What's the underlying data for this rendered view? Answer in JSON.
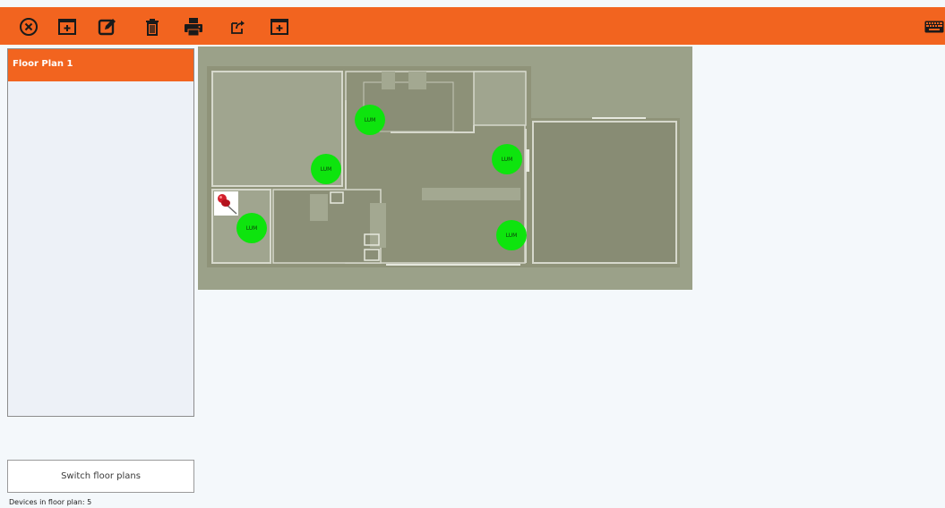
{
  "colors": {
    "accent": "#f2641f",
    "device_fill": "#0ee40e",
    "panel_bg": "#edf1f7"
  },
  "toolbar": {
    "buttons": [
      {
        "name": "close",
        "icon": "circle-x-icon"
      },
      {
        "name": "add",
        "icon": "add-box-icon"
      },
      {
        "name": "edit",
        "icon": "edit-icon"
      },
      {
        "name": "delete",
        "icon": "trash-icon"
      },
      {
        "name": "print",
        "icon": "printer-icon"
      },
      {
        "name": "export",
        "icon": "external-link-icon"
      },
      {
        "name": "add-secondary",
        "icon": "add-box-icon"
      }
    ],
    "right_icon": "keyboard-icon"
  },
  "sidebar": {
    "items": [
      {
        "label": "Floor Plan 1",
        "selected": true
      }
    ]
  },
  "switch_button": {
    "label": "Switch floor plans"
  },
  "status": {
    "devices_text": "Devices in floor plan: 5"
  },
  "floorplan": {
    "devices": [
      {
        "label": "LUM"
      },
      {
        "label": "LUM"
      },
      {
        "label": "LUM"
      },
      {
        "label": "LUM"
      },
      {
        "label": "LUM"
      }
    ],
    "pin_icon": "pushpin-icon"
  }
}
